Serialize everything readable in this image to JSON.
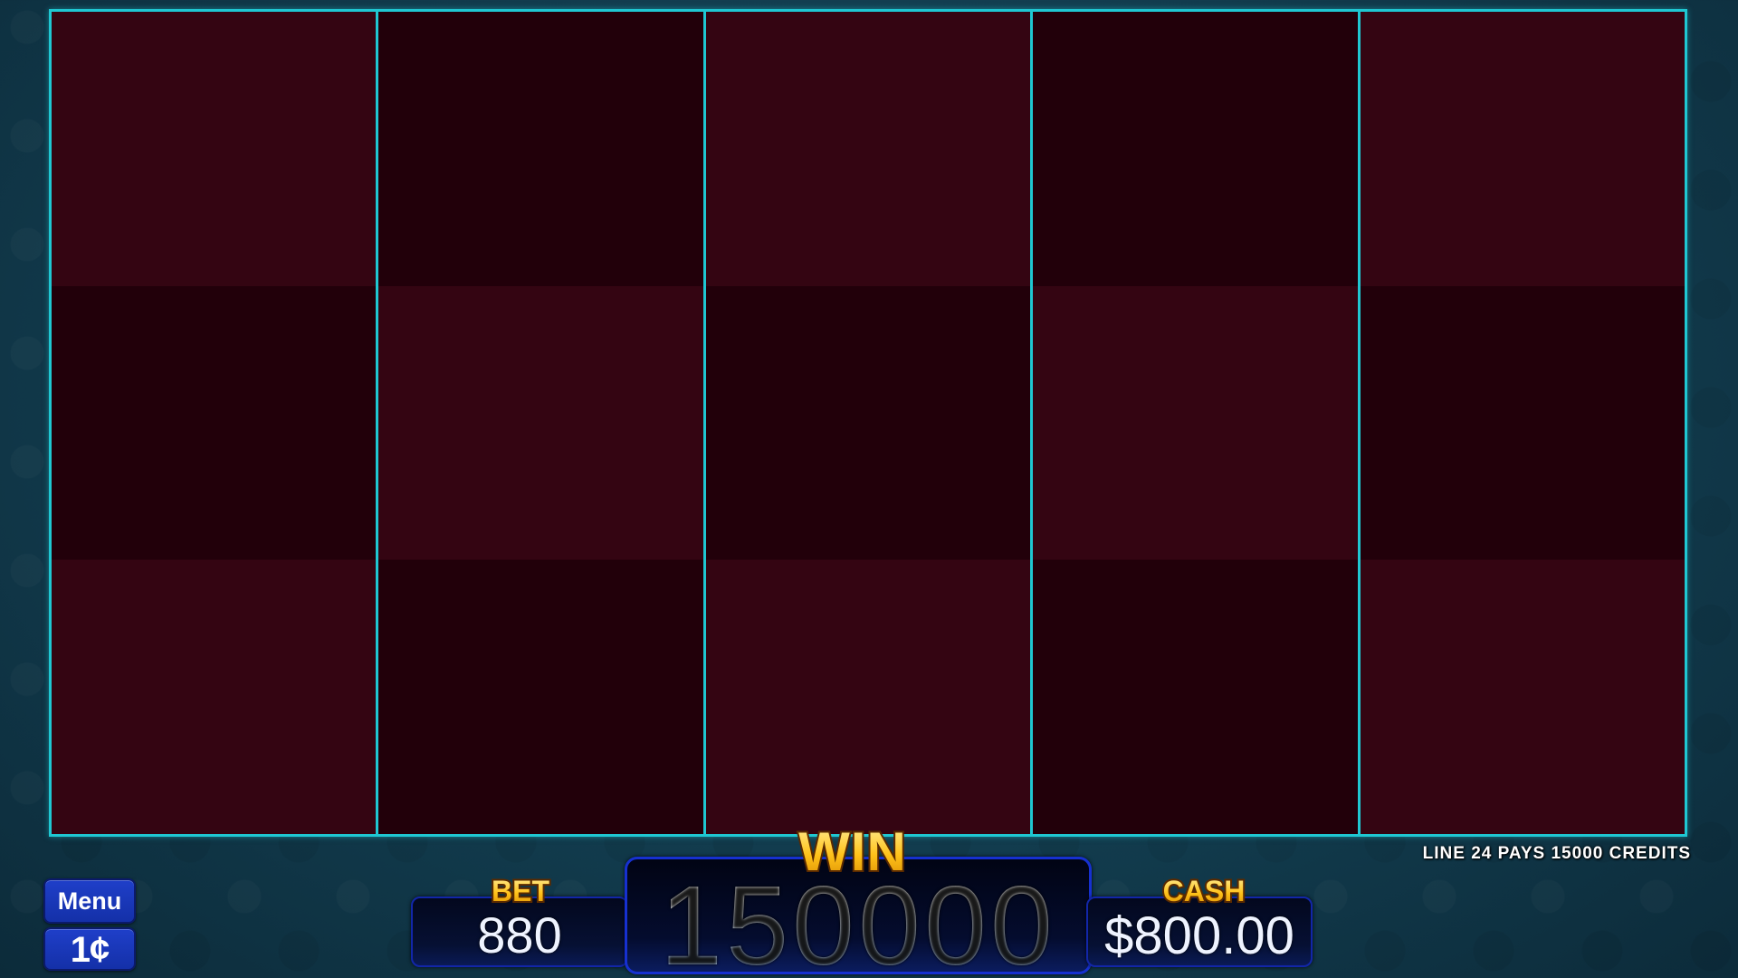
{
  "reels": [
    {
      "cells": [
        "light",
        "dark",
        "light"
      ]
    },
    {
      "cells": [
        "dark",
        "light",
        "dark"
      ]
    },
    {
      "cells": [
        "light",
        "dark",
        "light"
      ]
    },
    {
      "cells": [
        "dark",
        "light",
        "dark"
      ]
    },
    {
      "cells": [
        "light",
        "dark",
        "light"
      ]
    }
  ],
  "pay_message": "LINE 24 PAYS 15000 CREDITS",
  "buttons": {
    "menu_label": "Menu",
    "denom_label": "1¢"
  },
  "meters": {
    "bet_label": "BET",
    "bet_value": "880",
    "win_label": "WIN",
    "win_value": "150000",
    "cash_label": "CASH",
    "cash_value": "$800.00"
  },
  "colors": {
    "reel_frame": "#1fc7d2",
    "reel_cell_light": "#340512",
    "reel_cell_dark": "#22000a",
    "button_blue": "#1f3fc9",
    "label_gold": "#ffc21a"
  }
}
